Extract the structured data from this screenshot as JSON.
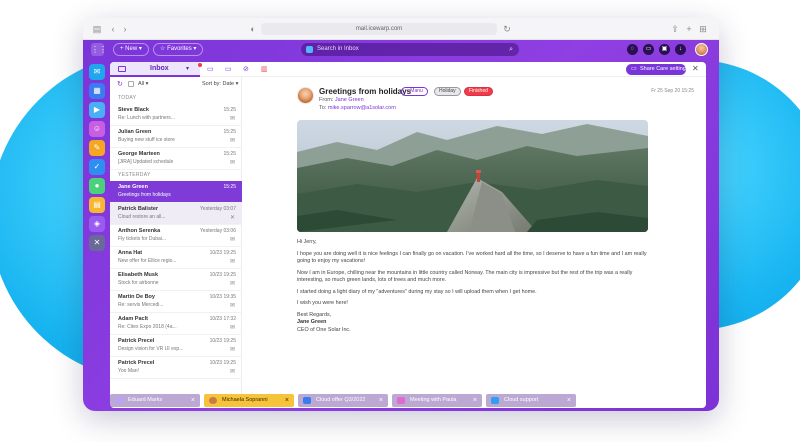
{
  "browser": {
    "url": "mail.icewarp.com"
  },
  "topbar": {
    "new_label": "+ New",
    "favorites_label": "Favorites",
    "search_placeholder": "Search in Inbox"
  },
  "toolbar": {
    "inbox_label": "Inbox",
    "share_label": "Share Care setting"
  },
  "list": {
    "filter_all": "All",
    "sort_label": "Sort by: Date",
    "groups": {
      "today": "TODAY",
      "yesterday": "YESTERDAY"
    },
    "rows": [
      {
        "name": "Steve Black",
        "time": "15:25",
        "preview": "Re: Lunch with partners..."
      },
      {
        "name": "Julian Green",
        "time": "15:25",
        "preview": "Buying new stuff ice store"
      },
      {
        "name": "George Marteen",
        "time": "15:25",
        "preview": "[JIRA] Updated schedule"
      },
      {
        "name": "Jane Green",
        "time": "15:25",
        "preview": "Greetings from holidays"
      },
      {
        "name": "Patrick Balister",
        "time": "Yesterday 03:07",
        "preview": "Cloud restore an all..."
      },
      {
        "name": "Anthon Serenka",
        "time": "Yesterday 03:06",
        "preview": "Fly tickets for Dubai..."
      },
      {
        "name": "Anna Hat",
        "time": "10/23 19:25",
        "preview": "New offer for Ellice regio..."
      },
      {
        "name": "Elisabeth Musk",
        "time": "10/23 19:25",
        "preview": "Stock for airbonne"
      },
      {
        "name": "Martin De Boy",
        "time": "10/23 19:35",
        "preview": "Re: servis Mercedi..."
      },
      {
        "name": "Adam Paclt",
        "time": "10/23 17:32",
        "preview": "Re: Citex Expo 2018 (4a..."
      },
      {
        "name": "Patrick Precel",
        "time": "10/23 19:25",
        "preview": "Design vision for VR UI exp..."
      },
      {
        "name": "Patrick Precel",
        "time": "10/23 19:25",
        "preview": "Yoo Man!"
      }
    ]
  },
  "message": {
    "subject": "Greetings from holidays",
    "tags": [
      "+ Manu",
      "Holiday",
      "Finished"
    ],
    "date": "Fr 25 Sep 20 15:25",
    "from_label": "From:",
    "from_name": "Jane Green",
    "to_label": "To:",
    "to_address": "mike.sparrow@a1solar.com",
    "body": {
      "greeting": "Hi Jerry,",
      "p1": "I hope you are doing well it is nice feelings I can finally go on vacation. I've worked hard all the time, so I deserve to have a fun time and I am really going to enjoy my vacations!",
      "p2": "Now I am in Europe, chilling near the mountains in little country called Norway. The main city is impressive but the rest of the trip was a really interesting, so much green lands, lots of trees and much more.",
      "p3": "I started doing a light diary of my \"adventures\" during my stay so I will upload them when I get home.",
      "p4": "I wish you were here!",
      "regards": "Best Regards,",
      "sig_name": "Jane Green",
      "sig_title": "CEO of One Solar Inc."
    }
  },
  "taskbar": [
    {
      "label": "Eduard Marks"
    },
    {
      "label": "Michaela Sopranni"
    },
    {
      "label": "Cloud offer Q3/2022"
    },
    {
      "label": "Meeting with Paula"
    },
    {
      "label": "Cloud support"
    }
  ],
  "colors": {
    "accent": "#7a35d8",
    "active_task": "#f6c33b",
    "alert": "#ef3b4a",
    "backdrop": "#16b3f0"
  }
}
